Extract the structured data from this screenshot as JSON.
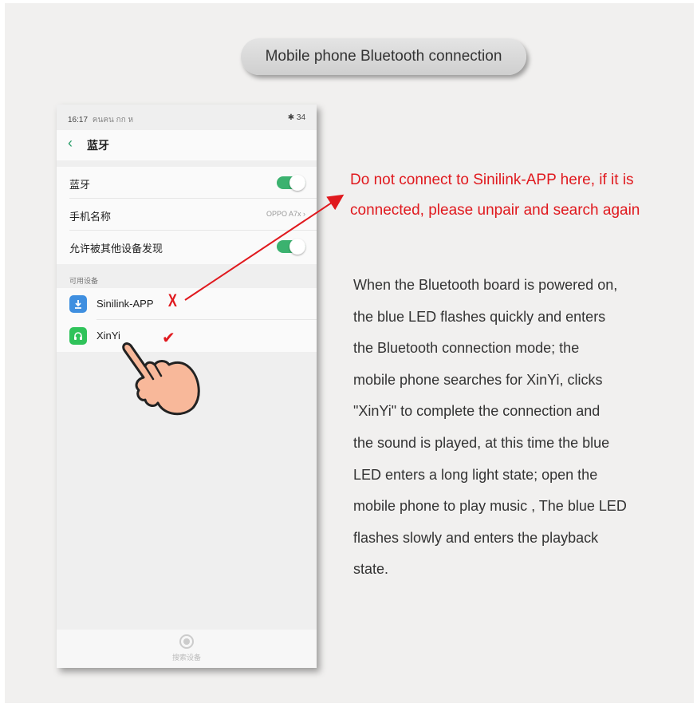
{
  "title": "Mobile phone Bluetooth connection",
  "phone": {
    "status": {
      "time": "16:17",
      "signal": "ฅนฅน กก ห",
      "battery": "✱ 34"
    },
    "nav": {
      "back": "‹",
      "title": "蓝牙"
    },
    "settings": [
      {
        "label": "蓝牙",
        "type": "toggle"
      },
      {
        "label": "手机名称",
        "value": "OPPO A7x ›"
      },
      {
        "label": "允许被其他设备发现",
        "type": "toggle"
      }
    ],
    "available_header": "可用设备",
    "devices": [
      {
        "name": "Sinilink-APP",
        "icon": "app-download-icon",
        "mark": "X",
        "color": "#3f8fe0"
      },
      {
        "name": "XinYi",
        "icon": "headset-icon",
        "mark": "✔",
        "color": "#2fc35a"
      }
    ],
    "bottom": {
      "label": "搜索设备"
    }
  },
  "warning_lines": [
    "Do not connect to Sinilink-APP here, if it is",
    "connected, please unpair and search again"
  ],
  "description": "When the Bluetooth board is powered on, the blue LED flashes quickly and enters the Bluetooth connection mode; the mobile phone searches for XinYi, clicks \"XinYi\" to complete the connection and the sound is played, at this time the blue LED enters a long light state; open the mobile phone to play music , The blue LED flashes slowly and enters the playback state.",
  "description_lines": [
    "When the Bluetooth board is powered on,",
    "the blue LED flashes quickly and enters",
    "the Bluetooth connection mode; the",
    "mobile phone searches for XinYi, clicks",
    "\"XinYi\" to complete the connection and",
    "the sound is played, at this time the blue",
    "LED enters a long light state; open the",
    "mobile phone to play music , The blue LED",
    "flashes slowly and enters the playback",
    "state."
  ],
  "colors": {
    "warning": "#e0191e",
    "toggle": "#3bb26f",
    "mark_x": "#e0191e",
    "mark_check": "#e0191e"
  }
}
